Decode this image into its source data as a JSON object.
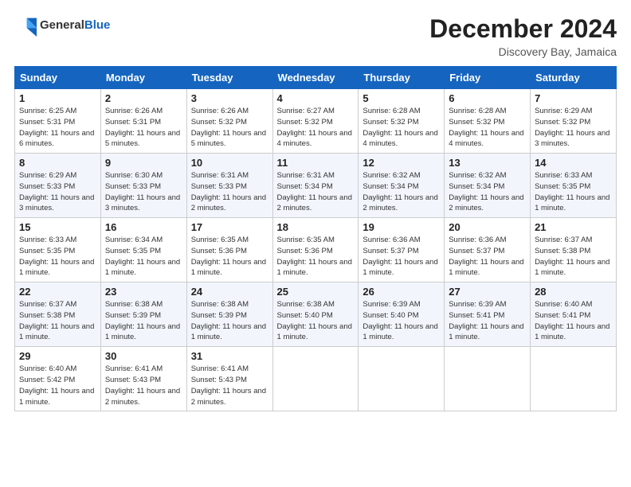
{
  "header": {
    "logo_general": "General",
    "logo_blue": "Blue",
    "month_title": "December 2024",
    "location": "Discovery Bay, Jamaica"
  },
  "days_of_week": [
    "Sunday",
    "Monday",
    "Tuesday",
    "Wednesday",
    "Thursday",
    "Friday",
    "Saturday"
  ],
  "weeks": [
    [
      {
        "day": "1",
        "sunrise": "Sunrise: 6:25 AM",
        "sunset": "Sunset: 5:31 PM",
        "daylight": "Daylight: 11 hours and 6 minutes."
      },
      {
        "day": "2",
        "sunrise": "Sunrise: 6:26 AM",
        "sunset": "Sunset: 5:31 PM",
        "daylight": "Daylight: 11 hours and 5 minutes."
      },
      {
        "day": "3",
        "sunrise": "Sunrise: 6:26 AM",
        "sunset": "Sunset: 5:32 PM",
        "daylight": "Daylight: 11 hours and 5 minutes."
      },
      {
        "day": "4",
        "sunrise": "Sunrise: 6:27 AM",
        "sunset": "Sunset: 5:32 PM",
        "daylight": "Daylight: 11 hours and 4 minutes."
      },
      {
        "day": "5",
        "sunrise": "Sunrise: 6:28 AM",
        "sunset": "Sunset: 5:32 PM",
        "daylight": "Daylight: 11 hours and 4 minutes."
      },
      {
        "day": "6",
        "sunrise": "Sunrise: 6:28 AM",
        "sunset": "Sunset: 5:32 PM",
        "daylight": "Daylight: 11 hours and 4 minutes."
      },
      {
        "day": "7",
        "sunrise": "Sunrise: 6:29 AM",
        "sunset": "Sunset: 5:32 PM",
        "daylight": "Daylight: 11 hours and 3 minutes."
      }
    ],
    [
      {
        "day": "8",
        "sunrise": "Sunrise: 6:29 AM",
        "sunset": "Sunset: 5:33 PM",
        "daylight": "Daylight: 11 hours and 3 minutes."
      },
      {
        "day": "9",
        "sunrise": "Sunrise: 6:30 AM",
        "sunset": "Sunset: 5:33 PM",
        "daylight": "Daylight: 11 hours and 3 minutes."
      },
      {
        "day": "10",
        "sunrise": "Sunrise: 6:31 AM",
        "sunset": "Sunset: 5:33 PM",
        "daylight": "Daylight: 11 hours and 2 minutes."
      },
      {
        "day": "11",
        "sunrise": "Sunrise: 6:31 AM",
        "sunset": "Sunset: 5:34 PM",
        "daylight": "Daylight: 11 hours and 2 minutes."
      },
      {
        "day": "12",
        "sunrise": "Sunrise: 6:32 AM",
        "sunset": "Sunset: 5:34 PM",
        "daylight": "Daylight: 11 hours and 2 minutes."
      },
      {
        "day": "13",
        "sunrise": "Sunrise: 6:32 AM",
        "sunset": "Sunset: 5:34 PM",
        "daylight": "Daylight: 11 hours and 2 minutes."
      },
      {
        "day": "14",
        "sunrise": "Sunrise: 6:33 AM",
        "sunset": "Sunset: 5:35 PM",
        "daylight": "Daylight: 11 hours and 1 minute."
      }
    ],
    [
      {
        "day": "15",
        "sunrise": "Sunrise: 6:33 AM",
        "sunset": "Sunset: 5:35 PM",
        "daylight": "Daylight: 11 hours and 1 minute."
      },
      {
        "day": "16",
        "sunrise": "Sunrise: 6:34 AM",
        "sunset": "Sunset: 5:35 PM",
        "daylight": "Daylight: 11 hours and 1 minute."
      },
      {
        "day": "17",
        "sunrise": "Sunrise: 6:35 AM",
        "sunset": "Sunset: 5:36 PM",
        "daylight": "Daylight: 11 hours and 1 minute."
      },
      {
        "day": "18",
        "sunrise": "Sunrise: 6:35 AM",
        "sunset": "Sunset: 5:36 PM",
        "daylight": "Daylight: 11 hours and 1 minute."
      },
      {
        "day": "19",
        "sunrise": "Sunrise: 6:36 AM",
        "sunset": "Sunset: 5:37 PM",
        "daylight": "Daylight: 11 hours and 1 minute."
      },
      {
        "day": "20",
        "sunrise": "Sunrise: 6:36 AM",
        "sunset": "Sunset: 5:37 PM",
        "daylight": "Daylight: 11 hours and 1 minute."
      },
      {
        "day": "21",
        "sunrise": "Sunrise: 6:37 AM",
        "sunset": "Sunset: 5:38 PM",
        "daylight": "Daylight: 11 hours and 1 minute."
      }
    ],
    [
      {
        "day": "22",
        "sunrise": "Sunrise: 6:37 AM",
        "sunset": "Sunset: 5:38 PM",
        "daylight": "Daylight: 11 hours and 1 minute."
      },
      {
        "day": "23",
        "sunrise": "Sunrise: 6:38 AM",
        "sunset": "Sunset: 5:39 PM",
        "daylight": "Daylight: 11 hours and 1 minute."
      },
      {
        "day": "24",
        "sunrise": "Sunrise: 6:38 AM",
        "sunset": "Sunset: 5:39 PM",
        "daylight": "Daylight: 11 hours and 1 minute."
      },
      {
        "day": "25",
        "sunrise": "Sunrise: 6:38 AM",
        "sunset": "Sunset: 5:40 PM",
        "daylight": "Daylight: 11 hours and 1 minute."
      },
      {
        "day": "26",
        "sunrise": "Sunrise: 6:39 AM",
        "sunset": "Sunset: 5:40 PM",
        "daylight": "Daylight: 11 hours and 1 minute."
      },
      {
        "day": "27",
        "sunrise": "Sunrise: 6:39 AM",
        "sunset": "Sunset: 5:41 PM",
        "daylight": "Daylight: 11 hours and 1 minute."
      },
      {
        "day": "28",
        "sunrise": "Sunrise: 6:40 AM",
        "sunset": "Sunset: 5:41 PM",
        "daylight": "Daylight: 11 hours and 1 minute."
      }
    ],
    [
      {
        "day": "29",
        "sunrise": "Sunrise: 6:40 AM",
        "sunset": "Sunset: 5:42 PM",
        "daylight": "Daylight: 11 hours and 1 minute."
      },
      {
        "day": "30",
        "sunrise": "Sunrise: 6:41 AM",
        "sunset": "Sunset: 5:43 PM",
        "daylight": "Daylight: 11 hours and 2 minutes."
      },
      {
        "day": "31",
        "sunrise": "Sunrise: 6:41 AM",
        "sunset": "Sunset: 5:43 PM",
        "daylight": "Daylight: 11 hours and 2 minutes."
      },
      null,
      null,
      null,
      null
    ]
  ]
}
